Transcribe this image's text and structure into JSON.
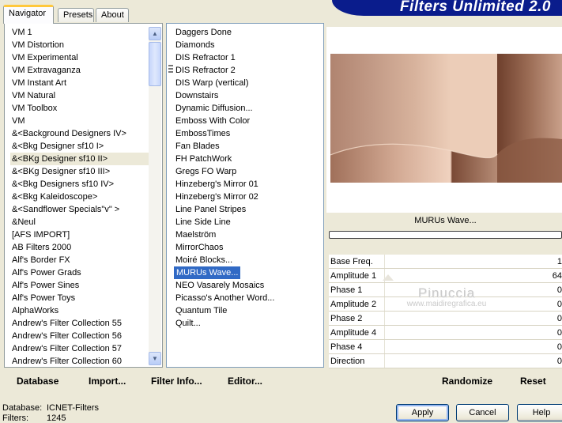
{
  "tabs": [
    {
      "label": "Navigator",
      "active": true
    },
    {
      "label": "Presets",
      "active": false
    },
    {
      "label": "About",
      "active": false
    }
  ],
  "banner_title": "Filters Unlimited 2.0",
  "categories": [
    "VM 1",
    "VM Distortion",
    "VM Experimental",
    "VM Extravaganza",
    "VM Instant Art",
    "VM Natural",
    "VM Toolbox",
    "VM",
    "&<Background Designers IV>",
    "&<Bkg Designer sf10 I>",
    "&<BKg Designer sf10 II>",
    "&<BKg Designer sf10 III>",
    "&<Bkg Designers sf10 IV>",
    "&<Bkg Kaleidoscope>",
    "&<Sandflower Specials\"v\" >",
    "&Neul",
    "[AFS IMPORT]",
    "AB Filters 2000",
    "Alf's Border FX",
    "Alf's Power Grads",
    "Alf's Power Sines",
    "Alf's Power Toys",
    "AlphaWorks",
    "Andrew's Filter Collection 55",
    "Andrew's Filter Collection 56",
    "Andrew's Filter Collection 57",
    "Andrew's Filter Collection 60"
  ],
  "selected_category": "&<BKg Designer sf10 II>",
  "filters": [
    "Daggers Done",
    "Diamonds",
    "DIS Refractor 1",
    "DIS Refractor 2",
    "DIS Warp (vertical)",
    "Downstairs",
    "Dynamic Diffusion...",
    "Emboss With Color",
    "EmbossTimes",
    "Fan Blades",
    "FH PatchWork",
    "Gregs FO Warp",
    "Hinzeberg's Mirror 01",
    "Hinzeberg's Mirror 02",
    "Line Panel Stripes",
    "Line Side Line",
    "Maelström",
    "MirrorChaos",
    "Moiré Blocks...",
    "MURUs Wave...",
    "NEO Vasarely Mosaics",
    "Picasso's Another Word...",
    "Quantum Tile",
    "Quilt..."
  ],
  "selected_filter": "MURUs Wave...",
  "filter_title": "MURUs Wave...",
  "progress": 0,
  "params": [
    {
      "label": "Base Freq.",
      "value": "1"
    },
    {
      "label": "Amplitude 1",
      "value": "64"
    },
    {
      "label": "Phase 1",
      "value": "0"
    },
    {
      "label": "Amplitude 2",
      "value": "0"
    },
    {
      "label": "Phase 2",
      "value": "0"
    },
    {
      "label": "Amplitude 4",
      "value": "0"
    },
    {
      "label": "Phase 4",
      "value": "0"
    },
    {
      "label": "Direction",
      "value": "0"
    }
  ],
  "watermark": {
    "line1": "Pinuccia",
    "line2": "www.maidiregrafica.eu"
  },
  "bottom_left_buttons": [
    "Database",
    "Import...",
    "Filter Info...",
    "Editor..."
  ],
  "bottom_right_buttons": [
    "Randomize",
    "Reset"
  ],
  "status": {
    "database_label": "Database:",
    "database_value": "ICNET-Filters",
    "filters_label": "Filters:",
    "filters_value": "1245"
  },
  "dialog_buttons": [
    "Apply",
    "Cancel",
    "Help"
  ],
  "colors": {
    "selection": "#316ac5",
    "banner": "#0a1c8c",
    "preview_light": "#e8c3ad",
    "preview_dark": "#7a4a36"
  }
}
